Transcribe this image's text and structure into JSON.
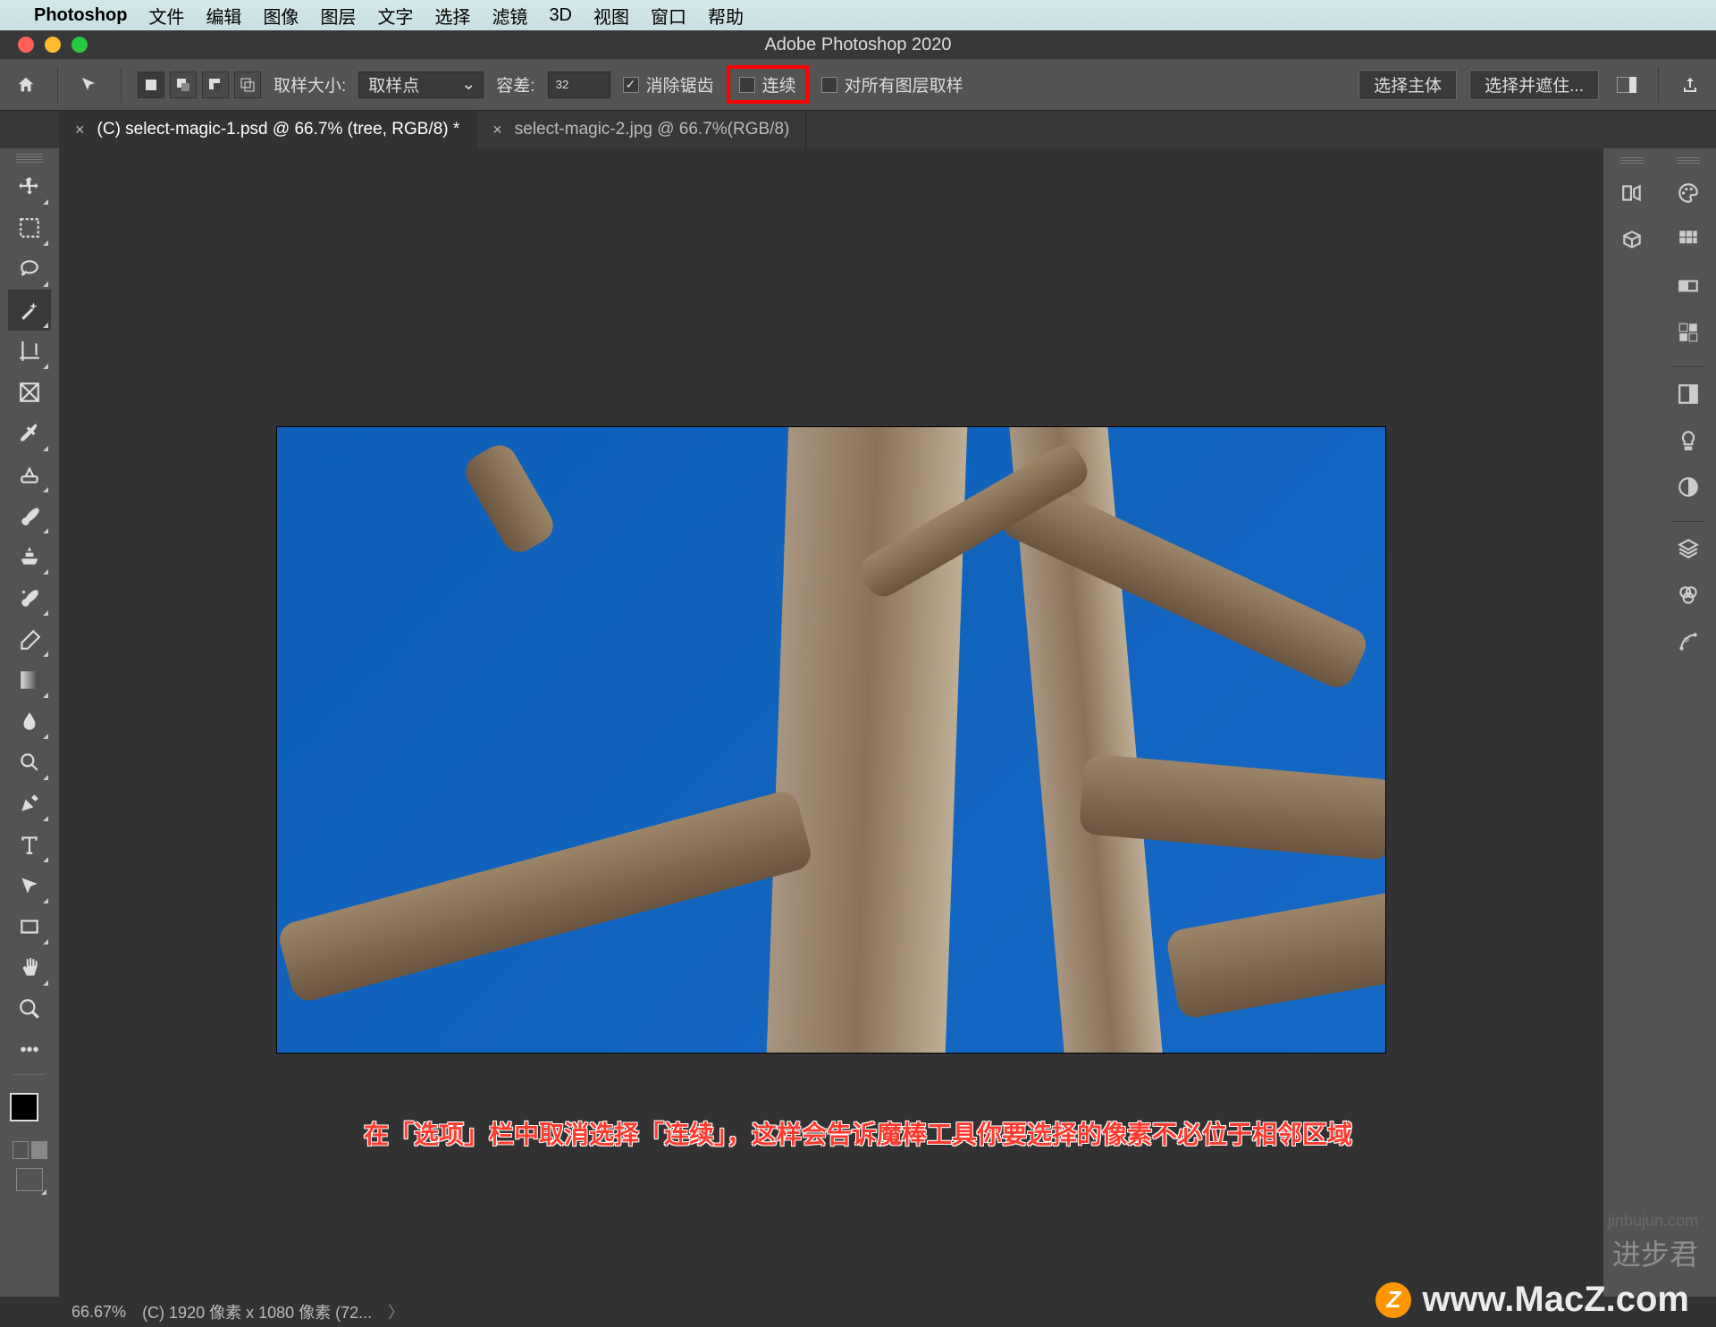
{
  "mac_menu": {
    "app_name": "Photoshop",
    "items": [
      "文件",
      "编辑",
      "图像",
      "图层",
      "文字",
      "选择",
      "滤镜",
      "3D",
      "视图",
      "窗口",
      "帮助"
    ]
  },
  "window_title": "Adobe Photoshop 2020",
  "options_bar": {
    "sample_size_label": "取样大小:",
    "sample_size_value": "取样点",
    "tolerance_label": "容差:",
    "tolerance_value": "32",
    "antialias_label": "消除锯齿",
    "antialias_checked": true,
    "contiguous_label": "连续",
    "contiguous_checked": false,
    "all_layers_label": "对所有图层取样",
    "all_layers_checked": false,
    "select_subject": "选择主体",
    "select_and_mask": "选择并遮住..."
  },
  "tabs": [
    {
      "label": "(C) select-magic-1.psd @ 66.7% (tree, RGB/8) *",
      "active": true
    },
    {
      "label": "select-magic-2.jpg @ 66.7%(RGB/8)",
      "active": false
    }
  ],
  "left_tools": [
    "move-tool",
    "marquee-tool",
    "lasso-tool",
    "magic-wand-tool",
    "crop-tool",
    "frame-tool",
    "eyedropper-tool",
    "healing-brush-tool",
    "brush-tool",
    "clone-stamp-tool",
    "history-brush-tool",
    "eraser-tool",
    "gradient-tool",
    "blur-tool",
    "dodge-tool",
    "pen-tool",
    "type-tool",
    "path-selection-tool",
    "rectangle-tool",
    "hand-tool",
    "zoom-tool"
  ],
  "right_panel_icons_col1": [
    "history-icon",
    "3d-icon"
  ],
  "right_panel_icons_col2": [
    "color-icon",
    "swatches-icon",
    "gradients-icon",
    "patterns-icon",
    "properties-icon",
    "bulb-icon",
    "adjustments-icon",
    "layers-icon",
    "channels-icon",
    "paths-icon"
  ],
  "overlay_instruction": "在「选项」栏中取消选择「连续」，这样会告诉魔棒工具你要选择的像素不必位于相邻区域",
  "status": {
    "zoom": "66.67%",
    "doc_info": "(C) 1920 像素 x 1080 像素 (72..."
  },
  "watermarks": {
    "site": "www.MacZ.com",
    "author": "进步君",
    "author_url": "jinbujun.com"
  }
}
